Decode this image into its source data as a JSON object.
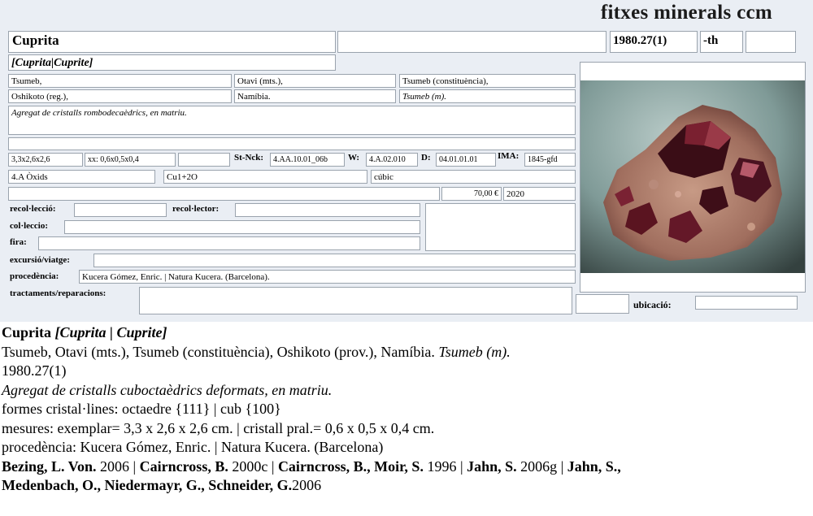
{
  "header": {
    "title": "fitxes minerals ccm"
  },
  "card": {
    "name": "Cuprita",
    "name_extra": "",
    "ref": "1980.27(1)",
    "ref_suffix": "-th",
    "ref_extra": "",
    "synonyms": "[Cuprita|Cuprite]",
    "loc": {
      "l1": "Tsumeb,",
      "l2": "Otavi (mts.),",
      "l3": "Tsumeb (constituència),",
      "l4": "Oshikoto (reg.),",
      "l5": "Namíbia.",
      "l6": "Tsumeb (m)."
    },
    "description": "Agregat de cristalls rombodecaèdrics, en matriu.",
    "size": "3,3x2,6x2,6",
    "crystal": "xx: 0,6x0,5x0,4",
    "st_nck_label": "St-Nck:",
    "st_nck": "4.AA.10.01_06b",
    "w_label": "W:",
    "w": "4.A.02.010",
    "d_label": "D:",
    "d": "04.01.01.01",
    "ima_label": "IMA:",
    "ima": "1845-gfd",
    "class": "4.A Òxids",
    "formula": "Cu1+2O",
    "system": "cúbic",
    "price": "70,00 €",
    "year": "2020",
    "labels": {
      "recollection": "recol·lecció:",
      "recollector": "recol·lector:",
      "collection": "col·leccio:",
      "fair": "fira:",
      "trip": "excursió/viatge:",
      "provenance": "procedència:",
      "treatments": "tractaments/reparacions:",
      "location": "ubicació:"
    },
    "provenance": "Kucera Gómez, Enric. | Natura Kucera. (Barcelona)."
  },
  "photo": {
    "subject": "cuprite crystals on matrix",
    "bg": "#7f9a97",
    "crystal": "#5a1420",
    "matrix": "#b58a7a"
  },
  "description_block": {
    "name": "Cuprita",
    "synonyms": "[Cuprita | Cuprite]",
    "locality": "Tsumeb, Otavi (mts.), Tsumeb (constituència), Oshikoto (prov.), Namíbia.",
    "locality_italic": "Tsumeb (m).",
    "ref": "1980.27(1)",
    "description": "Agregat de cristalls cuboctaèdrics deformats, en matriu.",
    "forms": "formes cristal·lines: octaedre {111} | cub {100}",
    "measures": "mesures: exemplar= 3,3 x 2,6 x 2,6 cm. | cristall pral.= 0,6 x 0,5 x 0,4 cm.",
    "provenance": "procedència: Kucera Gómez, Enric. | Natura Kucera. (Barcelona)",
    "refs": [
      {
        "author": "Bezing, L. Von.",
        "ref": "2006"
      },
      {
        "author": "Cairncross, B.",
        "ref": "2000c"
      },
      {
        "author": "Cairncross, B., Moir, S.",
        "ref": "1996"
      },
      {
        "author": "Jahn, S.",
        "ref": "2006g"
      },
      {
        "author": "Jahn, S.,",
        "ref": ""
      }
    ],
    "refs_line2_author": "Medenbach, O., Niedermayr, G., Schneider, G.",
    "refs_line2_ref": "2006"
  }
}
